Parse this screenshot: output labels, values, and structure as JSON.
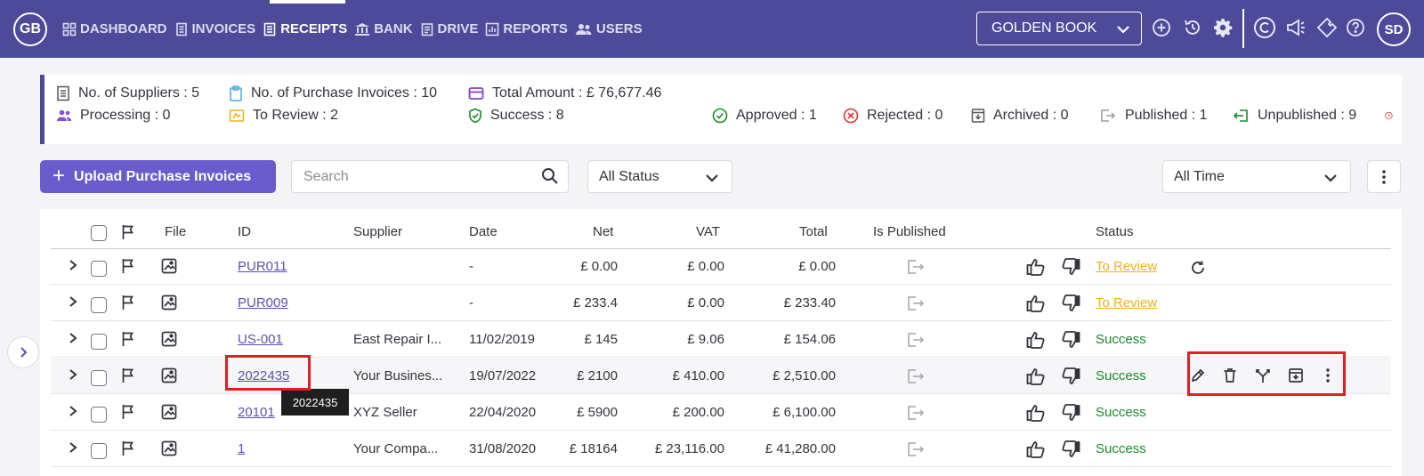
{
  "app": {
    "logo": "GB",
    "user_initials": "SD"
  },
  "nav": [
    {
      "label": "DASHBOARD",
      "icon": "grid-icon"
    },
    {
      "label": "INVOICES",
      "icon": "invoice-icon"
    },
    {
      "label": "RECEIPTS",
      "icon": "receipt-icon",
      "active": true
    },
    {
      "label": "BANK",
      "icon": "bank-icon"
    },
    {
      "label": "DRIVE",
      "icon": "drive-icon"
    },
    {
      "label": "REPORTS",
      "icon": "reports-icon"
    },
    {
      "label": "USERS",
      "icon": "users-icon"
    }
  ],
  "company": {
    "selected": "GOLDEN BOOK"
  },
  "summary": {
    "suppliers": "No. of Suppliers : 5",
    "purchase_invoices": "No. of Purchase Invoices : 10",
    "total_amount": "Total Amount : £ 76,677.46",
    "processing": "Processing : 0",
    "to_review": "To Review : 2",
    "success": "Success : 8",
    "approved": "Approved : 1",
    "rejected": "Rejected : 0",
    "archived": "Archived : 0",
    "published": "Published : 1",
    "unpublished": "Unpublished : 9"
  },
  "toolbar": {
    "upload_label": "Upload Purchase Invoices",
    "search_placeholder": "Search",
    "status_filter": "All Status",
    "time_filter": "All Time"
  },
  "columns": {
    "file": "File",
    "id": "ID",
    "supplier": "Supplier",
    "date": "Date",
    "net": "Net",
    "vat": "VAT",
    "total": "Total",
    "published": "Is Published",
    "status": "Status"
  },
  "rows": [
    {
      "id": "PUR011",
      "supplier": "",
      "date": "-",
      "net": "£ 0.00",
      "vat": "£ 0.00",
      "total": "£ 0.00",
      "status": "To Review"
    },
    {
      "id": "PUR009",
      "supplier": "",
      "date": "-",
      "net": "£ 233.4",
      "vat": "£ 0.00",
      "total": "£ 233.40",
      "status": "To Review"
    },
    {
      "id": "US-001",
      "supplier": "East Repair I...",
      "date": "11/02/2019",
      "net": "£ 145",
      "vat": "£ 9.06",
      "total": "£ 154.06",
      "status": "Success"
    },
    {
      "id": "2022435",
      "supplier": "Your Busines...",
      "date": "19/07/2022",
      "net": "£ 2100",
      "vat": "£ 410.00",
      "total": "£ 2,510.00",
      "status": "Success"
    },
    {
      "id": "20101",
      "supplier": "XYZ Seller",
      "date": "22/04/2020",
      "net": "£ 5900",
      "vat": "£ 200.00",
      "total": "£ 6,100.00",
      "status": "Success"
    },
    {
      "id": "1",
      "supplier": "Your Compa...",
      "date": "31/08/2020",
      "net": "£ 18164",
      "vat": "£ 23,116.00",
      "total": "£ 41,280.00",
      "status": "Success"
    }
  ],
  "tooltip": "2022435",
  "colors": {
    "nav_bg": "#4c4a99",
    "accent": "#6a5ccc",
    "success": "#198a2b",
    "review": "#f0b21f",
    "highlight": "#e01e26"
  }
}
